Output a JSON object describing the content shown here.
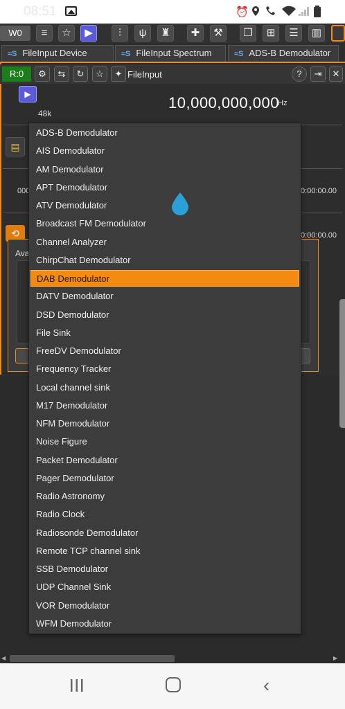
{
  "status_bar": {
    "time": "08:51",
    "icons": [
      "gallery-icon",
      "alarm-icon",
      "location-icon",
      "wifi-call-icon",
      "wifi-icon",
      "signal-icon",
      "battery-icon"
    ]
  },
  "toolbar": {
    "workspace_label": "W0",
    "icons": [
      "menu-icon",
      "star-icon",
      "play-icon",
      "channel-icon",
      "antenna-icon",
      "feature-icon",
      "add-preset-icon",
      "settings-icon",
      "window-icon",
      "grid-icon",
      "rows-icon",
      "columns-icon",
      "stack-icon"
    ]
  },
  "tabs": [
    {
      "label": "FileInput Device"
    },
    {
      "label": "FileInput Spectrum"
    },
    {
      "label": "ADS-B Demodulator"
    }
  ],
  "tab_icon_text": "≈S",
  "device": {
    "rx_label": "R:0",
    "title": "FileInput",
    "sample_rate": "48k",
    "frequency": "10,000,000,000",
    "frequency_unit": "Hz",
    "position_text": "000",
    "time_right_1": "0:00:00.00",
    "time_right_2": "0:00:00.00"
  },
  "dialog": {
    "label": "Ava"
  },
  "dropdown": {
    "selected_index": 8,
    "items": [
      "ADS-B Demodulator",
      "AIS Demodulator",
      "AM Demodulator",
      "APT Demodulator",
      "ATV Demodulator",
      "Broadcast FM Demodulator",
      "Channel Analyzer",
      "ChirpChat Demodulator",
      "DAB Demodulator",
      "DATV Demodulator",
      "DSD Demodulator",
      "File Sink",
      "FreeDV Demodulator",
      "Frequency Tracker",
      "Local channel sink",
      "M17 Demodulator",
      "NFM Demodulator",
      "Noise Figure",
      "Packet Demodulator",
      "Pager Demodulator",
      "Radio Astronomy",
      "Radio Clock",
      "Radiosonde Demodulator",
      "Remote TCP channel sink",
      "SSB Demodulator",
      "UDP Channel Sink",
      "VOR Demodulator",
      "WFM Demodulator"
    ]
  },
  "colors": {
    "accent": "#f08a18",
    "selected": "#f58a10",
    "rx_green": "#1a7f1a",
    "play_blue": "#5b5bd8",
    "drop_handle": "#2a9fd8"
  }
}
